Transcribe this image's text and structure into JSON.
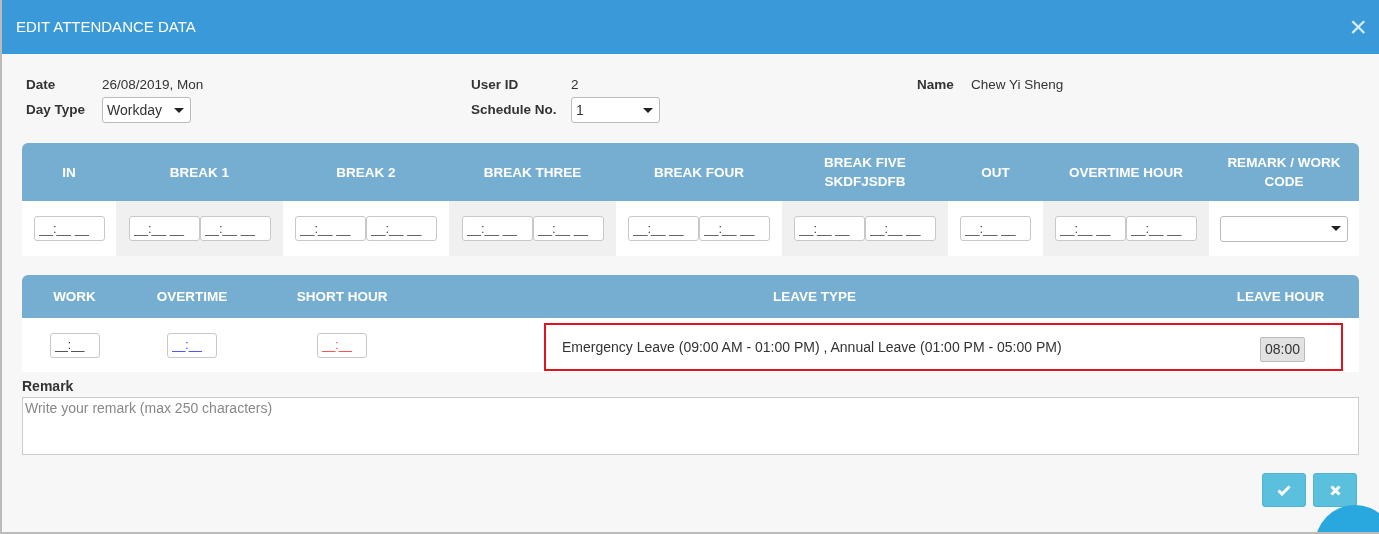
{
  "window": {
    "title": "EDIT ATTENDANCE DATA",
    "close": "×"
  },
  "info": [
    {
      "label": "Date",
      "value": "26/08/2019, Mon",
      "kind": "text"
    },
    {
      "label": "User ID",
      "value": "2",
      "kind": "text"
    },
    {
      "label": "Name",
      "value": "Chew Yi Sheng",
      "kind": "text"
    },
    {
      "label": "Day Type",
      "value": "Workday",
      "kind": "select"
    },
    {
      "label": "Schedule No.",
      "value": "1",
      "kind": "select"
    }
  ],
  "time_table": {
    "columns": [
      {
        "label": "IN",
        "placeholders": [
          "__:__ __"
        ]
      },
      {
        "label": "BREAK 1",
        "placeholders": [
          "__:__ __",
          "__:__ __"
        ]
      },
      {
        "label": "BREAK 2",
        "placeholders": [
          "__:__ __",
          "__:__ __"
        ]
      },
      {
        "label": "BREAK THREE",
        "placeholders": [
          "__:__ __",
          "__:__ __"
        ]
      },
      {
        "label": "BREAK FOUR",
        "placeholders": [
          "__:__ __",
          "__:__ __"
        ]
      },
      {
        "label": "BREAK FIVE SKDFJSDFB",
        "placeholders": [
          "__:__ __",
          "__:__ __"
        ]
      },
      {
        "label": "OUT",
        "placeholders": [
          "__:__ __"
        ]
      },
      {
        "label": "OVERTIME HOUR",
        "placeholders": [
          "__:__ __",
          "__:__ __"
        ]
      },
      {
        "label": "REMARK / WORK CODE",
        "kind": "select"
      }
    ]
  },
  "hours_table": {
    "columns": [
      {
        "label": "WORK",
        "placeholder": "__:__",
        "kind": "work"
      },
      {
        "label": "OVERTIME",
        "placeholder": "__:__",
        "kind": "overtime"
      },
      {
        "label": "SHORT HOUR",
        "placeholder": "__:__",
        "kind": "short"
      }
    ],
    "leave_type_label": "LEAVE TYPE",
    "leave_hour_label": "LEAVE HOUR",
    "leave": {
      "text": "Emergency Leave (09:00 AM - 01:00 PM) , Annual Leave (01:00 PM - 05:00 PM)",
      "hour": "08:00",
      "highlighted": true
    }
  },
  "remark": {
    "label": "Remark",
    "placeholder": "Write your remark (max 250 characters)"
  },
  "buttons": [
    {
      "kind": "confirm"
    },
    {
      "kind": "cancel"
    }
  ]
}
